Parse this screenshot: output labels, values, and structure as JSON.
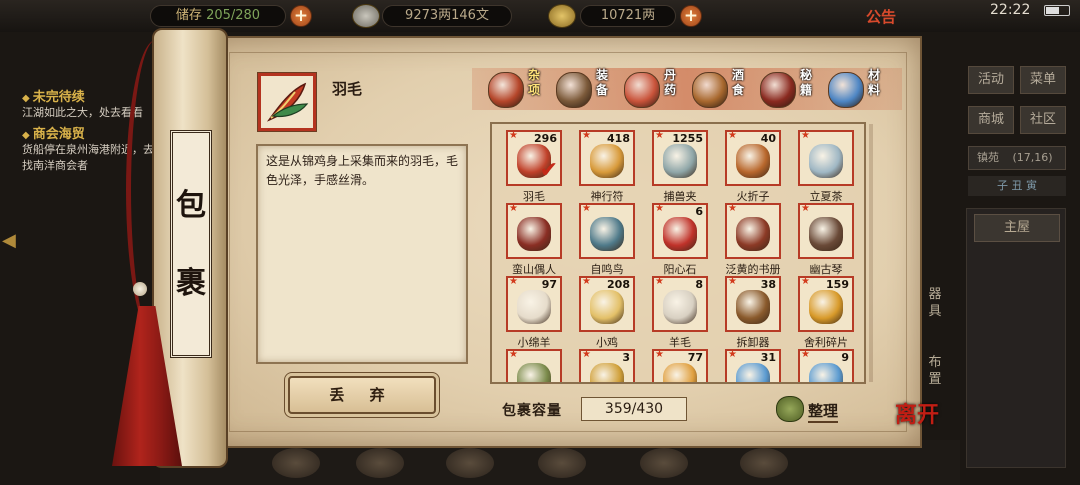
{
  "topbar": {
    "storage_label": "储存",
    "storage_value": "205/280",
    "copper": "9273两146文",
    "silver": "10721两",
    "notice": "公告",
    "time": "22:22"
  },
  "quest_log": {
    "quests": [
      {
        "title": "未完待续",
        "text": "江湖如此之大，处去看看"
      },
      {
        "title": "商会海贸",
        "text": "货船停在泉州海港附近，去找南洋商会者"
      }
    ]
  },
  "right_menu": {
    "activity": "活动",
    "menu": "菜单",
    "mall": "商城",
    "community": "社区",
    "location": "镇苑",
    "coords": "(17,16)",
    "time_period": "子 丑 寅",
    "home": "主屋",
    "equipment": "器具",
    "layout": "布置"
  },
  "bag": {
    "scroll_title_1": "包",
    "scroll_title_2": "裹",
    "selected": {
      "name": "羽毛",
      "description": "这是从锦鸡身上采集而来的羽毛，毛色光泽，手感丝滑。",
      "icon": "feather-icon"
    },
    "discard_label": "丢 弃",
    "capacity_label": "包裹容量",
    "capacity_value": "359/430",
    "sort_label": "整理",
    "leave_label": "离开",
    "tabs": [
      {
        "label": "杂项",
        "icon": "jar-icon",
        "color": "#b5462a",
        "active": true
      },
      {
        "label": "装备",
        "icon": "weapon-icon",
        "color": "#7c5a3a",
        "active": false
      },
      {
        "label": "丹药",
        "icon": "pill-icon",
        "color": "#c9533a",
        "active": false
      },
      {
        "label": "酒食",
        "icon": "food-icon",
        "color": "#a8682e",
        "active": false
      },
      {
        "label": "秘籍",
        "icon": "book-icon",
        "color": "#8a2a20",
        "active": false
      },
      {
        "label": "材料",
        "icon": "crystal-icon",
        "color": "#4e86c4",
        "active": false
      }
    ],
    "items": [
      {
        "name": "羽毛",
        "count": "296",
        "icon": "feather-icon",
        "color": "#c0412a",
        "selected": true
      },
      {
        "name": "神行符",
        "count": "418",
        "icon": "talisman-icon",
        "color": "#d89a3a",
        "selected": false
      },
      {
        "name": "捕兽夹",
        "count": "1255",
        "icon": "trap-icon",
        "color": "#8fa6a8",
        "selected": false
      },
      {
        "name": "火折子",
        "count": "40",
        "icon": "fire-starter-icon",
        "color": "#b8672c",
        "selected": false
      },
      {
        "name": "立夏茶",
        "count": "",
        "icon": "tea-bowl-icon",
        "color": "#9fb7c4",
        "selected": false
      },
      {
        "name": "蛮山偶人",
        "count": "",
        "icon": "doll-icon",
        "color": "#8a2e24",
        "selected": false
      },
      {
        "name": "自鸣鸟",
        "count": "",
        "icon": "bird-icon",
        "color": "#4f7a8a",
        "selected": false
      },
      {
        "name": "阳心石",
        "count": "6",
        "icon": "red-stone-icon",
        "color": "#c0322a",
        "selected": false
      },
      {
        "name": "泛黄的书册",
        "count": "",
        "icon": "old-book-icon",
        "color": "#8c3a26",
        "selected": false
      },
      {
        "name": "幽古琴",
        "count": "",
        "icon": "zither-icon",
        "color": "#6a4a38",
        "selected": false
      },
      {
        "name": "小绵羊",
        "count": "97",
        "icon": "sheep-icon",
        "color": "#e6dccb",
        "selected": false
      },
      {
        "name": "小鸡",
        "count": "208",
        "icon": "chick-icon",
        "color": "#e3c068",
        "selected": false
      },
      {
        "name": "羊毛",
        "count": "8",
        "icon": "wool-icon",
        "color": "#d8d0c2",
        "selected": false
      },
      {
        "name": "拆卸器",
        "count": "38",
        "icon": "toolbox-icon",
        "color": "#8a5a2c",
        "selected": false
      },
      {
        "name": "舍利碎片",
        "count": "159",
        "icon": "relic-icon",
        "color": "#d89a2a",
        "selected": false
      },
      {
        "name": "",
        "count": "",
        "icon": "herb-pile-icon",
        "color": "#7a8a4a",
        "selected": false
      },
      {
        "name": "",
        "count": "3",
        "icon": "gold-ingot-icon",
        "color": "#d0a03a",
        "selected": false
      },
      {
        "name": "",
        "count": "77",
        "icon": "scroll-gold-icon",
        "color": "#e0a040",
        "selected": false
      },
      {
        "name": "",
        "count": "31",
        "icon": "scroll-blue-icon",
        "color": "#5a9ad0",
        "selected": false
      },
      {
        "name": "",
        "count": "9",
        "icon": "scroll-blue-icon",
        "color": "#5a9ad0",
        "selected": false
      }
    ]
  }
}
